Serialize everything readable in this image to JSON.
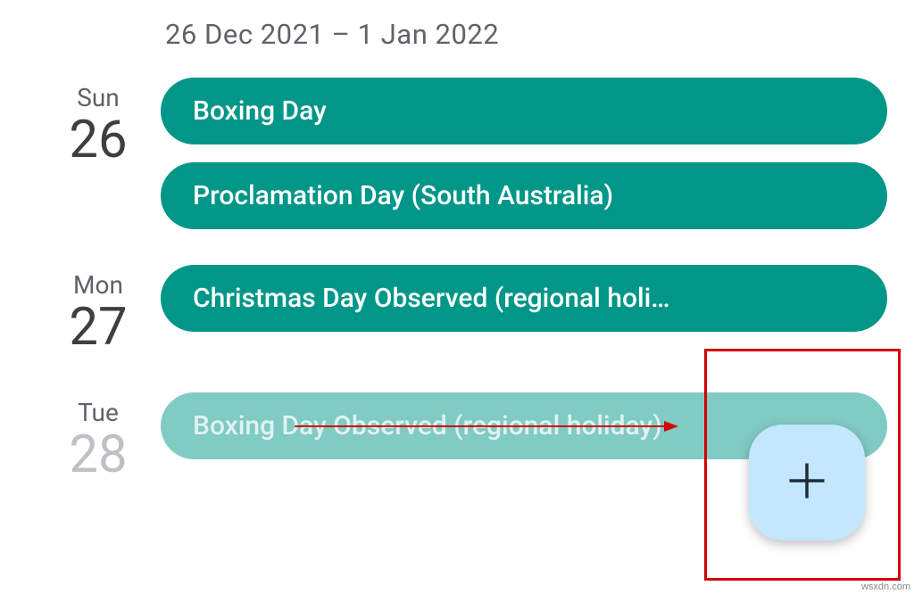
{
  "header": {
    "date_range": "26 Dec 2021 – 1 Jan 2022"
  },
  "days": [
    {
      "weekday": "Sun",
      "number": "26",
      "events": [
        {
          "title": "Boxing Day"
        },
        {
          "title": "Proclamation Day (South Australia)"
        }
      ]
    },
    {
      "weekday": "Mon",
      "number": "27",
      "events": [
        {
          "title": "Christmas Day Observed (regional holi…"
        }
      ]
    },
    {
      "weekday": "Tue",
      "number": "28",
      "events": [
        {
          "title": "Boxing Day Observed (regional holiday)"
        }
      ]
    }
  ],
  "colors": {
    "event_bg": "#009688",
    "fab_bg": "#c2e7ff",
    "annotation": "#d40000"
  },
  "watermark": "wsxdn.com"
}
